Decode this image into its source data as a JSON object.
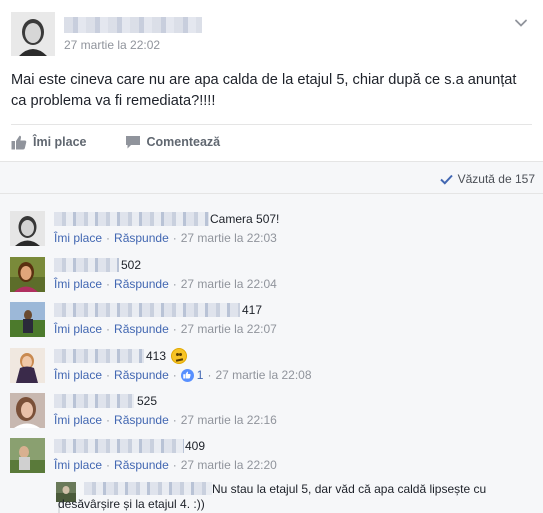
{
  "post": {
    "time": "27 martie la 22:02",
    "text": "Mai este cineva care nu are apa calda de la etajul 5, chiar după ce s.a anunțat ca problema va fi remediata?!!!!",
    "like_label": "Îmi place",
    "comment_label": "Comentează",
    "seen_label": "Văzută de 157"
  },
  "comment_labels": {
    "like": "Îmi place",
    "reply": "Răspunde",
    "dot": "·"
  },
  "comments": [
    {
      "text": "Camera 507!",
      "time": "27 martie la 22:03"
    },
    {
      "text": "502",
      "time": "27 martie la 22:04"
    },
    {
      "text": "417",
      "time": "27 martie la 22:07"
    },
    {
      "text": "413",
      "time": "27 martie la 22:08",
      "reactions": "1"
    },
    {
      "text": "525",
      "time": "27 martie la 22:16"
    },
    {
      "text": "409",
      "time": "27 martie la 22:20"
    }
  ],
  "reply": {
    "text": "Nu stau la etajul 5, dar văd că apa caldă lipsește cu desăvârșire și la etajul 4. :))"
  },
  "colors": {
    "link": "#4267b2",
    "meta": "#90949c",
    "background": "#f6f7f9"
  },
  "icons": [
    "chevron-down-icon",
    "thumbs-up-icon",
    "comment-icon",
    "checkmark-icon",
    "like-reaction-icon",
    "confused-emoji-icon"
  ]
}
